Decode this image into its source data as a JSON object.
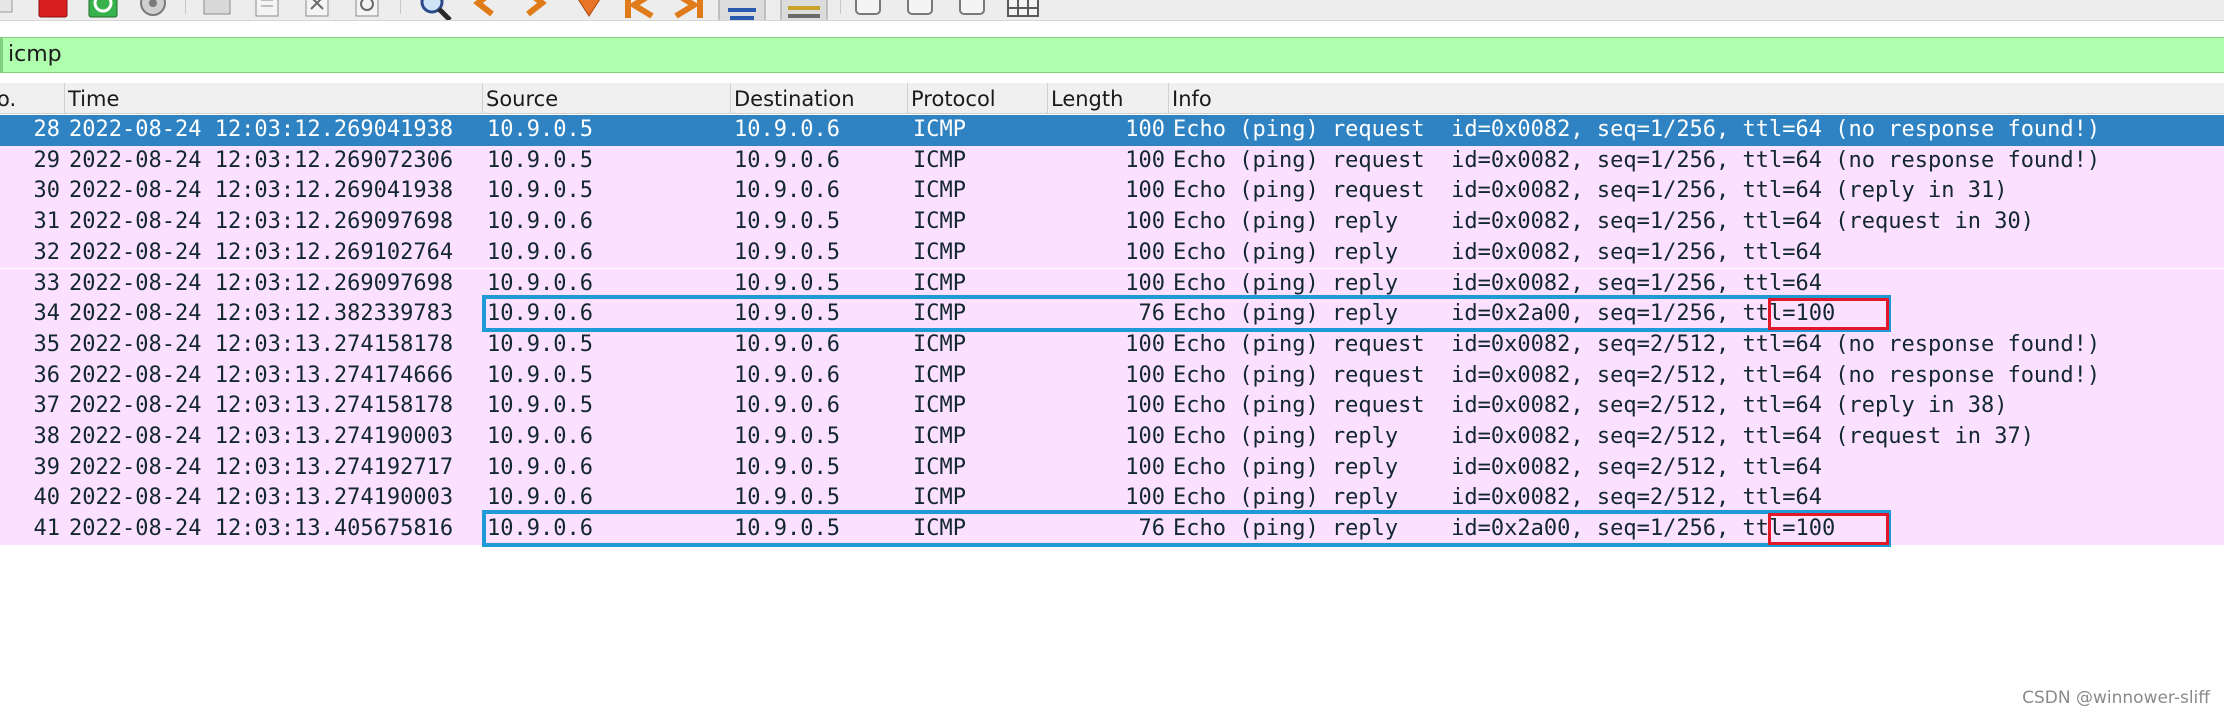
{
  "toolbar": {
    "icons": [
      "stop-capture-icon",
      "restart-capture-icon",
      "capture-options-icon",
      "open-file-icon",
      "save-file-icon",
      "close-file-icon",
      "reload-icon",
      "find-packet-icon",
      "go-back-icon",
      "go-forward-icon",
      "go-to-packet-icon",
      "go-first-icon",
      "go-last-icon",
      "autoscroll-icon",
      "colorize-icon",
      "zoom-in-icon",
      "zoom-out-icon",
      "normal-size-icon",
      "resize-columns-icon"
    ]
  },
  "filter": {
    "value": "icmp"
  },
  "columns": {
    "no": "o.",
    "time": "Time",
    "source": "Source",
    "destination": "Destination",
    "protocol": "Protocol",
    "length": "Length",
    "info": "Info"
  },
  "colors": {
    "selected_row_bg": "#2f83c3",
    "selected_row_fg": "#ffffff",
    "icmp_row_bg": "#fce0ff",
    "row_fg": "#12272e",
    "filter_bg": "#afffaf",
    "highlight_blue": "#1e9ad6",
    "highlight_red": "#e0182a"
  },
  "rows": [
    {
      "no": "28",
      "time": "2022-08-24 12:03:12.269041938",
      "source": "10.9.0.5",
      "destination": "10.9.0.6",
      "protocol": "ICMP",
      "length": "100",
      "info": "Echo (ping) request  id=0x0082, seq=1/256, ttl=64 (no response found!)",
      "selected": true
    },
    {
      "no": "29",
      "time": "2022-08-24 12:03:12.269072306",
      "source": "10.9.0.5",
      "destination": "10.9.0.6",
      "protocol": "ICMP",
      "length": "100",
      "info": "Echo (ping) request  id=0x0082, seq=1/256, ttl=64 (no response found!)"
    },
    {
      "no": "30",
      "time": "2022-08-24 12:03:12.269041938",
      "source": "10.9.0.5",
      "destination": "10.9.0.6",
      "protocol": "ICMP",
      "length": "100",
      "info": "Echo (ping) request  id=0x0082, seq=1/256, ttl=64 (reply in 31)"
    },
    {
      "no": "31",
      "time": "2022-08-24 12:03:12.269097698",
      "source": "10.9.0.6",
      "destination": "10.9.0.5",
      "protocol": "ICMP",
      "length": "100",
      "info": "Echo (ping) reply    id=0x0082, seq=1/256, ttl=64 (request in 30)"
    },
    {
      "no": "32",
      "time": "2022-08-24 12:03:12.269102764",
      "source": "10.9.0.6",
      "destination": "10.9.0.5",
      "protocol": "ICMP",
      "length": "100",
      "info": "Echo (ping) reply    id=0x0082, seq=1/256, ttl=64"
    },
    {
      "no": "33",
      "time": "2022-08-24 12:03:12.269097698",
      "source": "10.9.0.6",
      "destination": "10.9.0.5",
      "protocol": "ICMP",
      "length": "100",
      "info": "Echo (ping) reply    id=0x0082, seq=1/256, ttl=64"
    },
    {
      "no": "34",
      "time": "2022-08-24 12:03:12.382339783",
      "source": "10.9.0.6",
      "destination": "10.9.0.5",
      "protocol": "ICMP",
      "length": "76",
      "info": "Echo (ping) reply    id=0x2a00, seq=1/256, ttl=100",
      "boxed": true
    },
    {
      "no": "35",
      "time": "2022-08-24 12:03:13.274158178",
      "source": "10.9.0.5",
      "destination": "10.9.0.6",
      "protocol": "ICMP",
      "length": "100",
      "info": "Echo (ping) request  id=0x0082, seq=2/512, ttl=64 (no response found!)"
    },
    {
      "no": "36",
      "time": "2022-08-24 12:03:13.274174666",
      "source": "10.9.0.5",
      "destination": "10.9.0.6",
      "protocol": "ICMP",
      "length": "100",
      "info": "Echo (ping) request  id=0x0082, seq=2/512, ttl=64 (no response found!)"
    },
    {
      "no": "37",
      "time": "2022-08-24 12:03:13.274158178",
      "source": "10.9.0.5",
      "destination": "10.9.0.6",
      "protocol": "ICMP",
      "length": "100",
      "info": "Echo (ping) request  id=0x0082, seq=2/512, ttl=64 (reply in 38)"
    },
    {
      "no": "38",
      "time": "2022-08-24 12:03:13.274190003",
      "source": "10.9.0.6",
      "destination": "10.9.0.5",
      "protocol": "ICMP",
      "length": "100",
      "info": "Echo (ping) reply    id=0x0082, seq=2/512, ttl=64 (request in 37)"
    },
    {
      "no": "39",
      "time": "2022-08-24 12:03:13.274192717",
      "source": "10.9.0.6",
      "destination": "10.9.0.5",
      "protocol": "ICMP",
      "length": "100",
      "info": "Echo (ping) reply    id=0x0082, seq=2/512, ttl=64"
    },
    {
      "no": "40",
      "time": "2022-08-24 12:03:13.274190003",
      "source": "10.9.0.6",
      "destination": "10.9.0.5",
      "protocol": "ICMP",
      "length": "100",
      "info": "Echo (ping) reply    id=0x0082, seq=2/512, ttl=64"
    },
    {
      "no": "41",
      "time": "2022-08-24 12:03:13.405675816",
      "source": "10.9.0.6",
      "destination": "10.9.0.5",
      "protocol": "ICMP",
      "length": "76",
      "info": "Echo (ping) reply    id=0x2a00, seq=1/256, ttl=100",
      "boxed": true
    }
  ],
  "watermark": "CSDN @winnower-sliff"
}
